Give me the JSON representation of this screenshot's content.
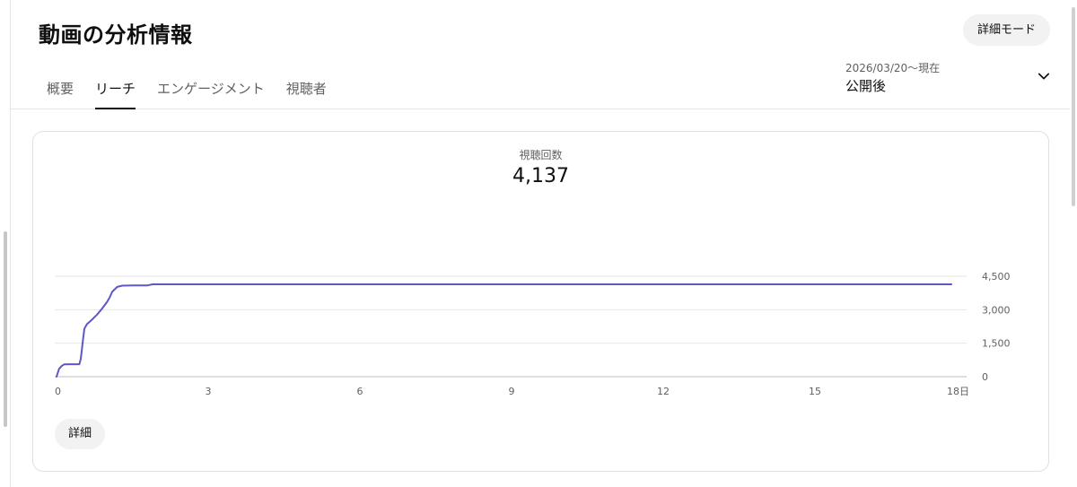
{
  "header": {
    "title": "動画の分析情報",
    "detail_mode_label": "詳細モード"
  },
  "tabs": [
    {
      "label": "概要",
      "active": false
    },
    {
      "label": "リーチ",
      "active": true
    },
    {
      "label": "エンゲージメント",
      "active": false
    },
    {
      "label": "視聴者",
      "active": false
    }
  ],
  "date_range": {
    "range_text": "2026/03/20〜現在",
    "selected": "公開後",
    "icon": "chevron-down-icon"
  },
  "metric": {
    "label": "視聴回数",
    "value": "4,137"
  },
  "detail_button_label": "詳細",
  "colors": {
    "line": "#5e57c6",
    "gridline": "#e5e5e5",
    "baseline": "#bdbdbd"
  },
  "chart_data": {
    "type": "line",
    "x_ticks": [
      0,
      3,
      6,
      9,
      12,
      15,
      18
    ],
    "x_tick_labels": [
      "0",
      "3",
      "6",
      "9",
      "12",
      "15",
      "18日"
    ],
    "y_ticks": [
      0,
      1500,
      3000,
      4500
    ],
    "y_tick_labels": [
      "0",
      "1,500",
      "3,000",
      "4,500"
    ],
    "xlim": [
      0,
      18
    ],
    "ylim": [
      0,
      4500
    ],
    "y_axis_side": "right",
    "grid": true,
    "series": [
      {
        "x": [
          0,
          0.05,
          0.1,
          0.15,
          0.25,
          0.35,
          0.45,
          0.48,
          0.5,
          0.52,
          0.55,
          0.6,
          0.7,
          0.8,
          0.9,
          0.95,
          1.0,
          1.05,
          1.1,
          1.2,
          1.3,
          1.5,
          1.8,
          1.9,
          3,
          6,
          9,
          12,
          15,
          17.7
        ],
        "y": [
          0,
          350,
          480,
          550,
          560,
          560,
          560,
          800,
          1200,
          1600,
          2150,
          2350,
          2550,
          2780,
          3050,
          3200,
          3350,
          3550,
          3800,
          4020,
          4080,
          4090,
          4090,
          4137,
          4137,
          4137,
          4137,
          4137,
          4137,
          4137
        ]
      }
    ]
  }
}
